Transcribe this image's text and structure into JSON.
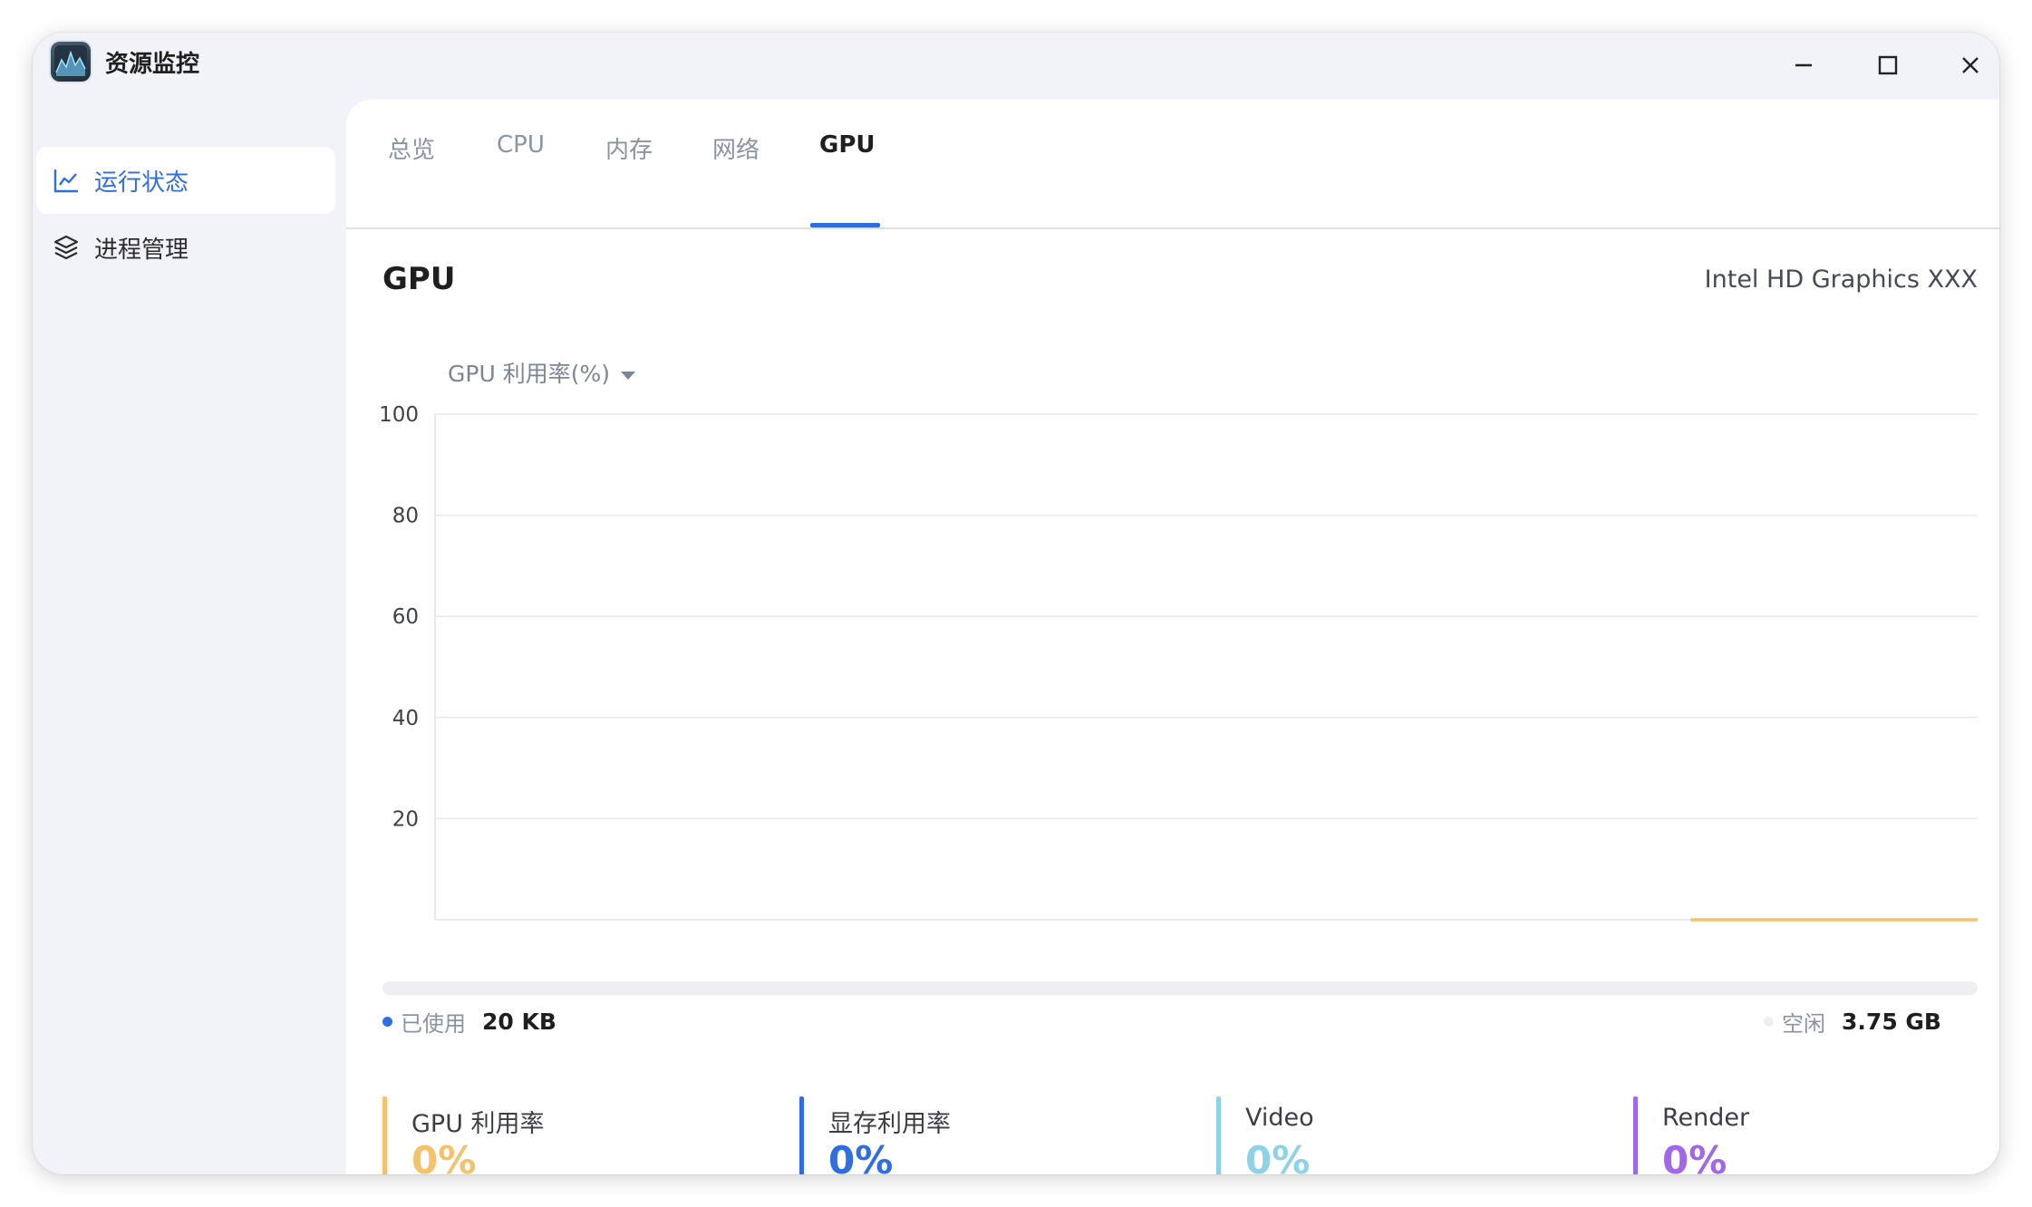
{
  "window": {
    "title": "资源监控"
  },
  "sidebar": {
    "items": [
      {
        "label": "运行状态",
        "icon": "line-chart-icon",
        "active": true
      },
      {
        "label": "进程管理",
        "icon": "layers-icon",
        "active": false
      }
    ]
  },
  "tabs": [
    {
      "label": "总览",
      "active": false
    },
    {
      "label": "CPU",
      "active": false
    },
    {
      "label": "内存",
      "active": false
    },
    {
      "label": "网络",
      "active": false
    },
    {
      "label": "GPU",
      "active": true
    }
  ],
  "gpu": {
    "title": "GPU",
    "device_name": "Intel HD Graphics XXX",
    "metric_select": "GPU 利用率(%)"
  },
  "chart_data": {
    "type": "line",
    "title": "",
    "xlabel": "",
    "ylabel": "",
    "ylim": [
      0,
      100
    ],
    "y_ticks": [
      "100",
      "80",
      "60",
      "40",
      "20"
    ],
    "grid": true,
    "series": [
      {
        "color": "#f5c26b",
        "values": [
          0,
          0,
          0,
          0,
          0
        ],
        "x_start_fraction": 0.814
      }
    ]
  },
  "memory": {
    "used_label": "已使用",
    "used_value": "20 KB",
    "free_label": "空闲",
    "free_value": "3.75 GB",
    "used_color": "#2f6de0",
    "free_color": "#eeeff2"
  },
  "stats": [
    {
      "name": "GPU 利用率",
      "value": "0%",
      "color": "#f5c26b"
    },
    {
      "name": "显存利用率",
      "value": "0%",
      "color": "#2f6de0"
    },
    {
      "name": "Video",
      "value": "0%",
      "color": "#8ed2e8"
    },
    {
      "name": "Render",
      "value": "0%",
      "color": "#a267e8"
    }
  ]
}
